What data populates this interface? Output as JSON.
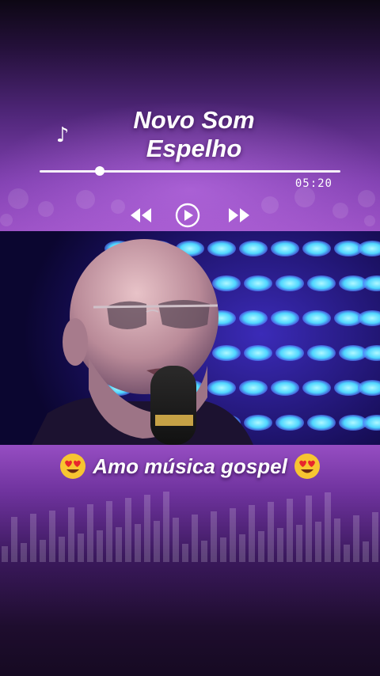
{
  "player": {
    "title_line1": "Novo Som",
    "title_line2": "Espelho",
    "duration": "05:20",
    "progress": 0.2,
    "icons": {
      "note": "music-note-icon",
      "rewind": "rewind-icon",
      "play": "play-icon",
      "forward": "fast-forward-icon"
    }
  },
  "caption": {
    "text": "Amo música gospel",
    "emoji": "heart-eyes-emoji"
  },
  "colors": {
    "accent": "#9a4cc0",
    "led": "#4fd6ff",
    "text": "#ffffff"
  }
}
